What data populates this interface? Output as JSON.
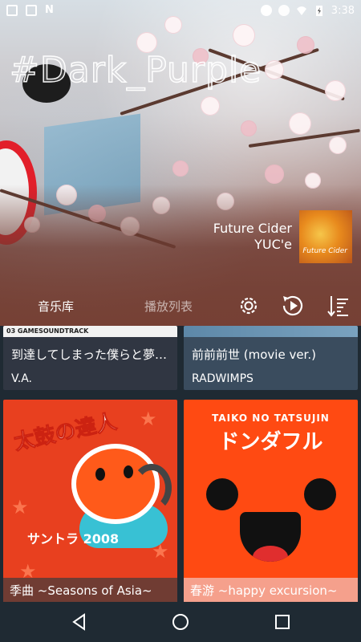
{
  "status_bar": {
    "time": "3:38",
    "left_icons": [
      "image-icon",
      "image-icon",
      "n-notification-icon"
    ],
    "right_icons": [
      "minus-circle-icon",
      "alarm-icon",
      "wifi-icon",
      "battery-charging-icon"
    ]
  },
  "header": {
    "theme_title": "#Dark_Purple",
    "now_playing": {
      "title": "Future Cider",
      "artist": "YUC'e"
    }
  },
  "tabs": [
    {
      "label": "音乐库",
      "active": true
    },
    {
      "label": "播放列表",
      "active": false
    }
  ],
  "toolbar_icons": [
    "settings-icon",
    "replay-play-icon",
    "sort-icon"
  ],
  "albums": [
    {
      "title": "到達してしまった僕らと夢…",
      "artist": "V.A.",
      "art_text": "03 GAMESOUNDTRACK"
    },
    {
      "title": "前前前世 (movie ver.)",
      "artist": "RADWIMPS"
    },
    {
      "title": "季曲 ~Seasons of Asia~",
      "art_text": "太鼓の達人",
      "art_sub": "サントラ 2008"
    },
    {
      "title": "春游 ~happy excursion~",
      "art_text": "TAIKO NO TATSUJIN",
      "art_sub": "ドンダフル"
    }
  ],
  "navbar": [
    "back-icon",
    "home-icon",
    "recents-icon"
  ],
  "colors": {
    "accent": "#e8401f",
    "tab_active": "#ffffff",
    "background": "#1f2a33"
  }
}
